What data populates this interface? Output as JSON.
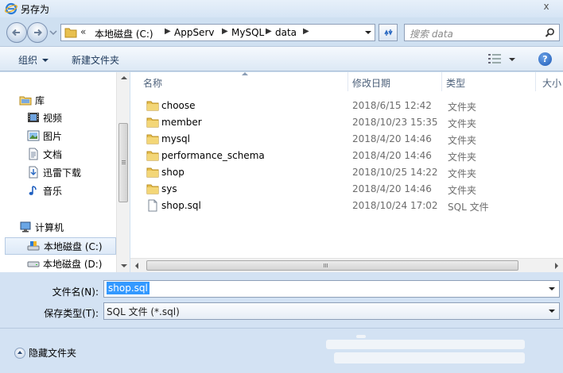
{
  "window": {
    "title": "另存为",
    "close_glyph": "x"
  },
  "address": {
    "more": "«",
    "crumbs": [
      "本地磁盘 (C:)",
      "AppServ",
      "MySQL",
      "data"
    ]
  },
  "search": {
    "placeholder": "搜索 data"
  },
  "toolbar": {
    "organize": "组织",
    "new_folder": "新建文件夹",
    "help": "?"
  },
  "nav": {
    "library": "库",
    "videos": "视频",
    "pictures": "图片",
    "documents": "文档",
    "thunder": "迅雷下载",
    "music": "音乐",
    "computer": "计算机",
    "drive_c": "本地磁盘 (C:)",
    "drive_d": "本地磁盘 (D:)"
  },
  "columns": {
    "name": "名称",
    "date": "修改日期",
    "type": "类型",
    "size": "大小"
  },
  "files": [
    {
      "name": "choose",
      "date": "2018/6/15 12:42",
      "type": "文件夹",
      "icon": "folder-icon"
    },
    {
      "name": "member",
      "date": "2018/10/23 15:35",
      "type": "文件夹",
      "icon": "folder-icon"
    },
    {
      "name": "mysql",
      "date": "2018/4/20 14:46",
      "type": "文件夹",
      "icon": "folder-icon"
    },
    {
      "name": "performance_schema",
      "date": "2018/4/20 14:46",
      "type": "文件夹",
      "icon": "folder-icon"
    },
    {
      "name": "shop",
      "date": "2018/10/25 14:22",
      "type": "文件夹",
      "icon": "folder-icon"
    },
    {
      "name": "sys",
      "date": "2018/4/20 14:46",
      "type": "文件夹",
      "icon": "folder-icon"
    },
    {
      "name": "shop.sql",
      "date": "2018/10/24 17:02",
      "type": "SQL 文件",
      "icon": "file-icon"
    }
  ],
  "form": {
    "filename_label": "文件名(N):",
    "filename_value": "shop.sql",
    "filetype_label": "保存类型(T):",
    "filetype_value": "SQL 文件 (*.sql)"
  },
  "footer": {
    "hide_folders": "隐藏文件夹"
  },
  "colors": {
    "accent": "#3399ff",
    "frame": "#cfe0f1",
    "folder": "#e8c04f"
  }
}
